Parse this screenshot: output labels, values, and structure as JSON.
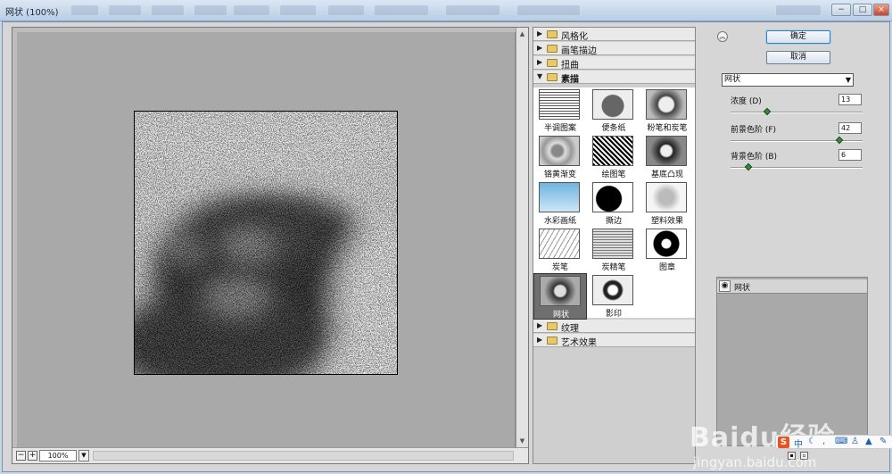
{
  "window": {
    "title": "网状 (100%)"
  },
  "preview": {
    "zoom_value": "100%",
    "zoom_out": "−",
    "zoom_in": "+",
    "zoom_drop": "▼"
  },
  "gallery": {
    "categories_top": [
      {
        "label": "风格化",
        "icon": "triangle-right-icon"
      },
      {
        "label": "画笔描边",
        "icon": "triangle-right-icon"
      },
      {
        "label": "扭曲",
        "icon": "triangle-right-icon"
      },
      {
        "label": "素描",
        "icon": "triangle-down-icon",
        "open": true
      }
    ],
    "sketch_filters": [
      "半调图案",
      "便条纸",
      "粉笔和炭笔",
      "铬黄渐变",
      "绘图笔",
      "基底凸现",
      "水彩画纸",
      "撕边",
      "塑料效果",
      "炭笔",
      "炭精笔",
      "图章",
      "网状",
      "影印"
    ],
    "selected_filter": "网状",
    "categories_bottom": [
      {
        "label": "纹理",
        "icon": "triangle-right-icon"
      },
      {
        "label": "艺术效果",
        "icon": "triangle-right-icon"
      }
    ]
  },
  "actions": {
    "ok_label": "确定",
    "cancel_label": "取消",
    "collapse_icon": "double-chevron-up-icon"
  },
  "settings": {
    "filter_name": "网状",
    "params": [
      {
        "label": "浓度 (D)",
        "value": "13",
        "level_fraction": 0.27
      },
      {
        "label": "前景色阶 (F)",
        "value": "42",
        "level_fraction": 0.84
      },
      {
        "label": "背景色阶 (B)",
        "value": "6",
        "level_fraction": 0.12
      }
    ]
  },
  "layers": {
    "items": [
      {
        "label": "网状",
        "icon": "eye-icon"
      }
    ]
  },
  "watermark": {
    "brand": "Baidu经验",
    "url": "jingyan.baidu.com"
  },
  "colors": {
    "accent": "#3c7fb1",
    "ime": "#e9531f"
  }
}
